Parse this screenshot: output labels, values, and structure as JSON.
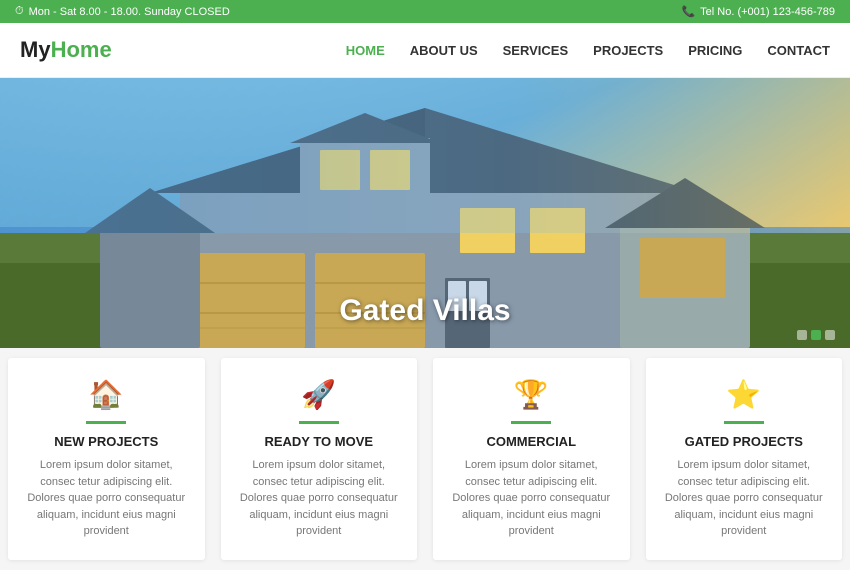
{
  "topbar": {
    "hours": "Mon - Sat 8.00 - 18.00. Sunday CLOSED",
    "phone": "Tel No. (+001) 123-456-789",
    "clock_icon": "⏰",
    "phone_icon": "📞"
  },
  "header": {
    "logo_my": "My",
    "logo_home": "Home",
    "nav": [
      {
        "label": "HOME",
        "active": true
      },
      {
        "label": "ABOUT US",
        "active": false
      },
      {
        "label": "SERVICES",
        "active": false
      },
      {
        "label": "PROJECTS",
        "active": false
      },
      {
        "label": "PRICING",
        "active": false
      },
      {
        "label": "CONTACT",
        "active": false
      }
    ]
  },
  "hero": {
    "title": "Gated Villas"
  },
  "cards": [
    {
      "icon": "🏠",
      "title": "NEW PROJECTS",
      "text": "Lorem ipsum dolor sitamet, consec tetur adipiscing elit. Dolores quae porro consequatur aliquam, incidunt eius magni provident"
    },
    {
      "icon": "🚀",
      "title": "READY TO MOVE",
      "text": "Lorem ipsum dolor sitamet, consec tetur adipiscing elit. Dolores quae porro consequatur aliquam, incidunt eius magni provident"
    },
    {
      "icon": "🏆",
      "title": "COMMERCIAL",
      "text": "Lorem ipsum dolor sitamet, consec tetur adipiscing elit. Dolores quae porro consequatur aliquam, incidunt eius magni provident"
    },
    {
      "icon": "⭐",
      "title": "GATED PROJECTS",
      "text": "Lorem ipsum dolor sitamet, consec tetur adipiscing elit. Dolores quae porro consequatur aliquam, incidunt eius magni provident"
    }
  ],
  "colors": {
    "green": "#4caf50",
    "dark": "#222222",
    "gray_text": "#777777"
  }
}
